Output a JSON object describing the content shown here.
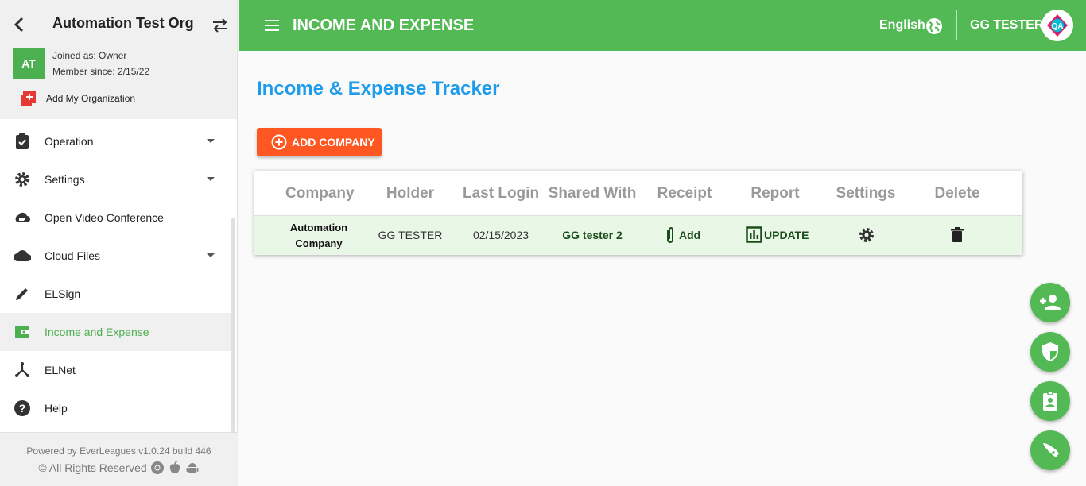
{
  "sidebar": {
    "org_name": "Automation Test Org",
    "avatar_initials": "AT",
    "joined_as": "Joined as: Owner",
    "member_since": "Member since: 2/15/22",
    "add_org_label": "Add My Organization",
    "items": [
      {
        "label": "Operation",
        "icon": "clipboard-check-icon",
        "expandable": true
      },
      {
        "label": "Settings",
        "icon": "gear-icon",
        "expandable": true
      },
      {
        "label": "Open Video Conference",
        "icon": "video-cloud-icon",
        "expandable": false
      },
      {
        "label": "Cloud Files",
        "icon": "cloud-icon",
        "expandable": true
      },
      {
        "label": "ELSign",
        "icon": "pen-icon",
        "expandable": false
      },
      {
        "label": "Income and Expense",
        "icon": "wallet-icon",
        "expandable": false,
        "active": true
      },
      {
        "label": "ELNet",
        "icon": "network-icon",
        "expandable": false
      },
      {
        "label": "Help",
        "icon": "help-icon",
        "expandable": false
      }
    ],
    "footer": {
      "powered_by": "Powered by EverLeagues v1.0.24 build 446",
      "rights": "© All Rights Reserved"
    }
  },
  "topbar": {
    "title": "INCOME AND EXPENSE",
    "language": "English",
    "user_name": "GG TESTER"
  },
  "main": {
    "page_title": "Income & Expense Tracker",
    "add_company_label": "ADD COMPANY",
    "table": {
      "headers": [
        "Company",
        "Holder",
        "Last Login",
        "Shared With",
        "Receipt",
        "Report",
        "Settings",
        "Delete"
      ],
      "rows": [
        {
          "company_line1": "Automation",
          "company_line2": "Company",
          "holder": "GG TESTER",
          "last_login": "02/15/2023",
          "shared_with": "GG tester 2",
          "receipt": "Add",
          "report": "UPDATE"
        }
      ]
    }
  },
  "colors": {
    "brand_green": "#52b955",
    "accent_orange": "#ff5722",
    "title_blue": "#1e9be9",
    "active_row": "#e9f7e7"
  },
  "fabs": [
    "add-person-icon",
    "shield-icon",
    "id-badge-icon",
    "rocket-icon"
  ]
}
